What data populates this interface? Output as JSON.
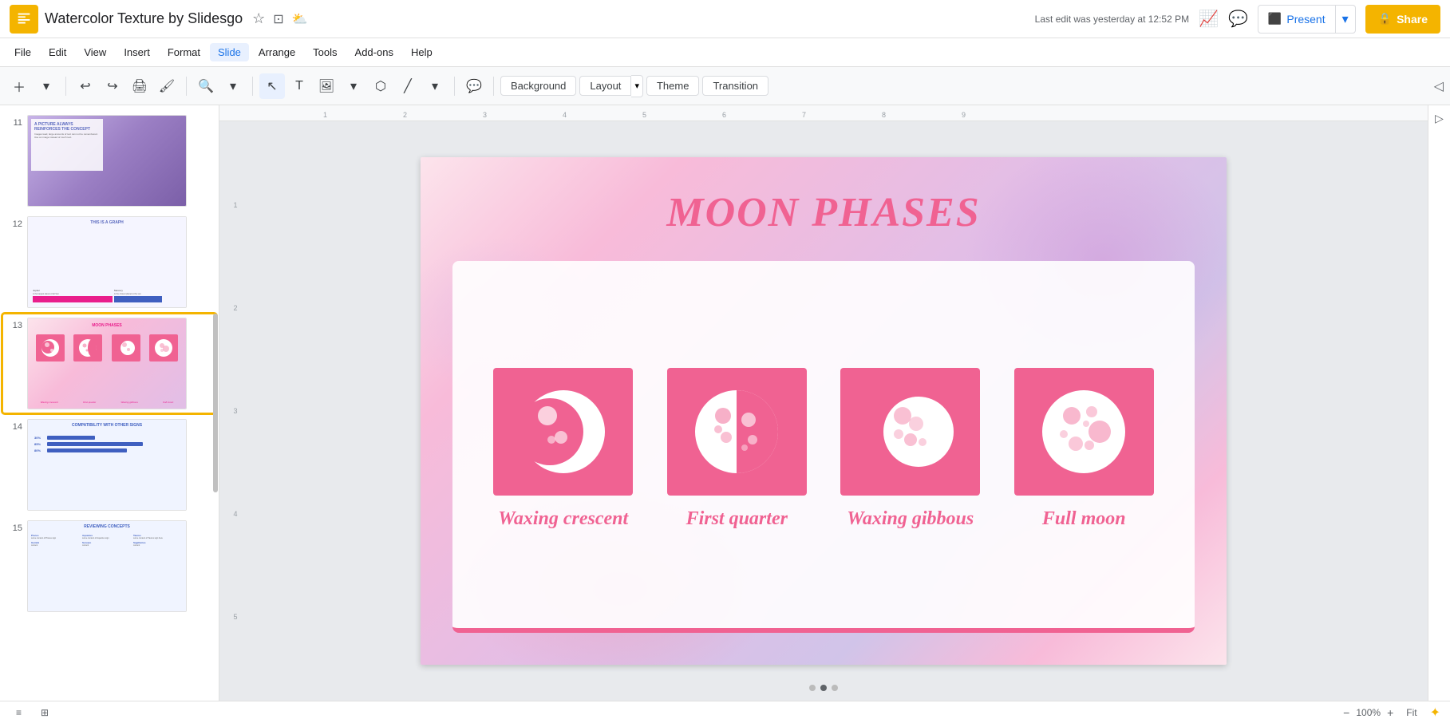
{
  "app": {
    "title": "Watercolor Texture by Slidesgo",
    "logo_color": "#F4B400"
  },
  "title_bar": {
    "doc_title": "Watercolor Texture by Slidesgo",
    "last_edit": "Last edit was yesterday at 12:52 PM",
    "star_icon": "★",
    "folder_icon": "📁",
    "cloud_icon": "☁",
    "present_label": "Present",
    "share_label": "🔒 Share",
    "comments_icon": "💬",
    "activity_icon": "📈"
  },
  "menu": {
    "items": [
      "File",
      "Edit",
      "View",
      "Insert",
      "Format",
      "Slide",
      "Arrange",
      "Tools",
      "Add-ons",
      "Help"
    ]
  },
  "toolbar": {
    "background_label": "Background",
    "layout_label": "Layout",
    "theme_label": "Theme",
    "transition_label": "Transition"
  },
  "sidebar": {
    "slides": [
      {
        "num": "11",
        "type": "purple-image"
      },
      {
        "num": "12",
        "type": "graph"
      },
      {
        "num": "13",
        "type": "moon-phases",
        "active": true
      },
      {
        "num": "14",
        "type": "compatibility"
      },
      {
        "num": "15",
        "type": "reviewing"
      }
    ]
  },
  "slide": {
    "title": "MOON PHASES",
    "phases": [
      {
        "id": "waxing-crescent",
        "label": "Waxing crescent"
      },
      {
        "id": "first-quarter",
        "label": "First quarter"
      },
      {
        "id": "waxing-gibbous",
        "label": "Waxing gibbous"
      },
      {
        "id": "full-moon",
        "label": "Full moon"
      }
    ]
  },
  "ruler": {
    "marks": [
      "1",
      "2",
      "3",
      "4",
      "5",
      "6",
      "7",
      "8",
      "9"
    ]
  },
  "bottom": {
    "grid_icon": "⊞",
    "list_icon": "≡",
    "zoom_label": "100%",
    "fit_label": "Fit",
    "assistant_icon": "✦"
  }
}
